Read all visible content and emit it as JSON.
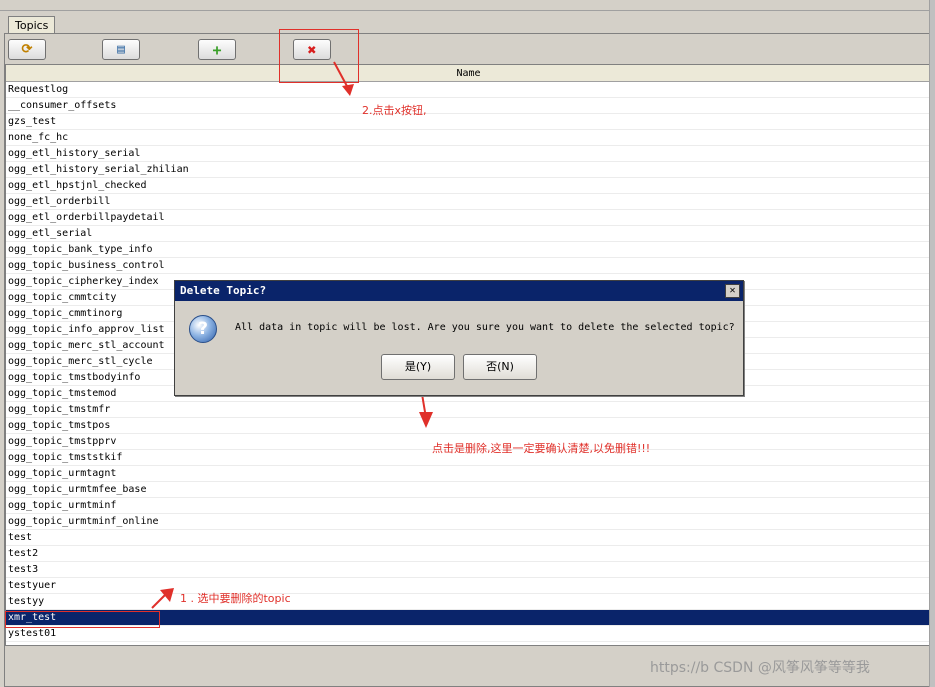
{
  "tab": {
    "label": "Topics"
  },
  "toolbar": {
    "buttons": [
      {
        "icon": "refresh-icon",
        "glyph": "⟳"
      },
      {
        "icon": "print-icon",
        "glyph": "▤"
      },
      {
        "icon": "add-icon",
        "glyph": "+"
      },
      {
        "icon": "delete-icon",
        "glyph": "✖"
      }
    ]
  },
  "table": {
    "column_header": "Name",
    "rows": [
      "Requestlog",
      "__consumer_offsets",
      "gzs_test",
      "none_fc_hc",
      "ogg_etl_history_serial",
      "ogg_etl_history_serial_zhilian",
      "ogg_etl_hpstjnl_checked",
      "ogg_etl_orderbill",
      "ogg_etl_orderbillpaydetail",
      "ogg_etl_serial",
      "ogg_topic_bank_type_info",
      "ogg_topic_business_control",
      "ogg_topic_cipherkey_index",
      "ogg_topic_cmmtcity",
      "ogg_topic_cmmtinorg",
      "ogg_topic_info_approv_list",
      "ogg_topic_merc_stl_account",
      "ogg_topic_merc_stl_cycle",
      "ogg_topic_tmstbodyinfo",
      "ogg_topic_tmstemod",
      "ogg_topic_tmstmfr",
      "ogg_topic_tmstpos",
      "ogg_topic_tmstpprv",
      "ogg_topic_tmststkif",
      "ogg_topic_urmtagnt",
      "ogg_topic_urmtmfee_base",
      "ogg_topic_urmtminf",
      "ogg_topic_urmtminf_online",
      "test",
      "test2",
      "test3",
      "testyuer",
      "testyy",
      "xmr_test",
      "ystest01"
    ],
    "selected_index": 33
  },
  "dialog": {
    "title": "Delete Topic?",
    "close_glyph": "✕",
    "icon_glyph": "?",
    "message": "All data in topic will be lost. Are you sure you want to delete the selected topic?",
    "yes_label": "是(Y)",
    "no_label": "否(N)"
  },
  "annotations": {
    "note1": "1 . 选中要删除的topic",
    "note2": "2.点击x按钮,",
    "note3": "点击是删除,这里一定要确认清楚,以免删错!!!"
  },
  "watermark": "https://b CSDN @风筝风筝等等我",
  "colors": {
    "selection": "#0a246a",
    "annotation": "#e0302a",
    "title_bar": "#0a246a"
  }
}
